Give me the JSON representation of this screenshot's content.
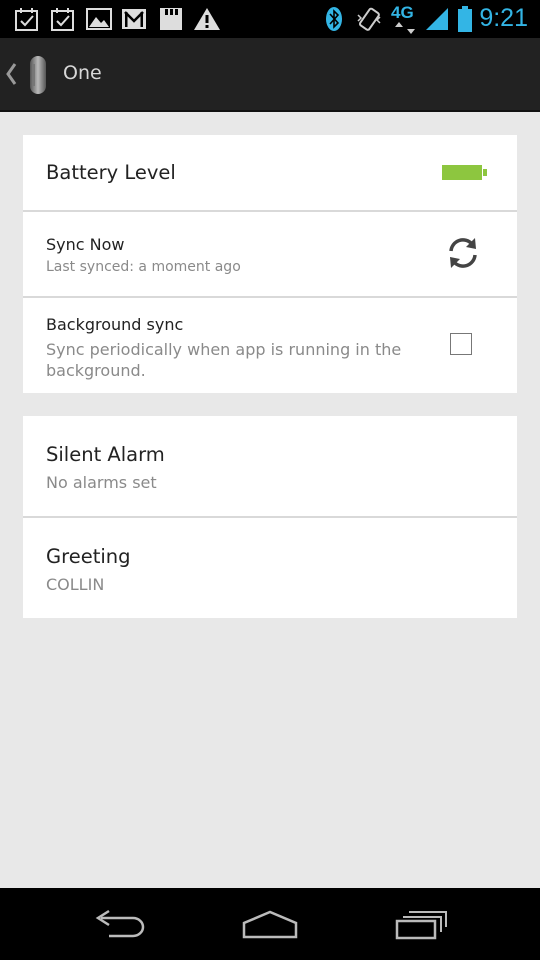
{
  "status_bar": {
    "time": "9:21",
    "network_label": "4G",
    "icons": [
      "calendar-check-icon",
      "calendar-check-icon",
      "image-icon",
      "gmail-icon",
      "sd-card-icon",
      "warning-icon",
      "bluetooth-icon",
      "vibrate-icon",
      "4g-icon",
      "signal-icon",
      "battery-icon"
    ],
    "accent_color": "#33b5e5"
  },
  "action_bar": {
    "title": "One"
  },
  "settings": {
    "battery": {
      "title": "Battery Level",
      "level_color": "#8dc63f"
    },
    "sync_now": {
      "title": "Sync Now",
      "subtitle": "Last synced: a moment ago"
    },
    "background_sync": {
      "title": "Background sync",
      "subtitle": "Sync periodically when app is running in the background.",
      "checked": false
    },
    "silent_alarm": {
      "title": "Silent Alarm",
      "subtitle": "No alarms set"
    },
    "greeting": {
      "title": "Greeting",
      "subtitle": "COLLIN"
    }
  },
  "nav_bar": {
    "buttons": [
      "back-icon",
      "home-icon",
      "recent-apps-icon"
    ]
  }
}
